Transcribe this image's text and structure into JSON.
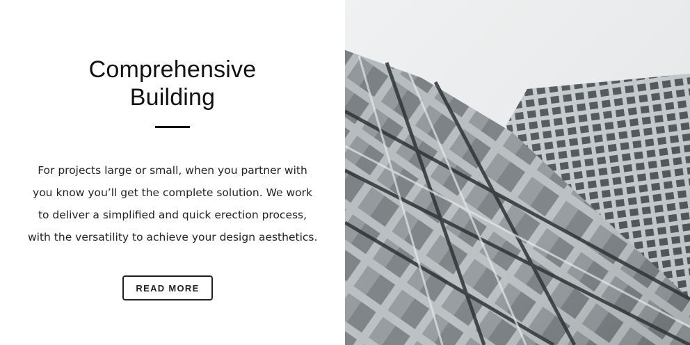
{
  "hero": {
    "title_line1": "Comprehensive",
    "title_line2": "Building",
    "body_lines": [
      "For projects large or small, when you partner with",
      "you know you’ll get the complete solution. We work",
      "to deliver a simplified and quick erection process,",
      "with the versatility to achieve your design aesthetics."
    ],
    "button_label": "READ MORE"
  },
  "image": {
    "subject": "building-facade-photo",
    "colors": {
      "sky": "#e9ebec",
      "glass_dark": "#3f4446",
      "glass_mid": "#7b8184",
      "frame_light": "#cfd3d5"
    }
  }
}
